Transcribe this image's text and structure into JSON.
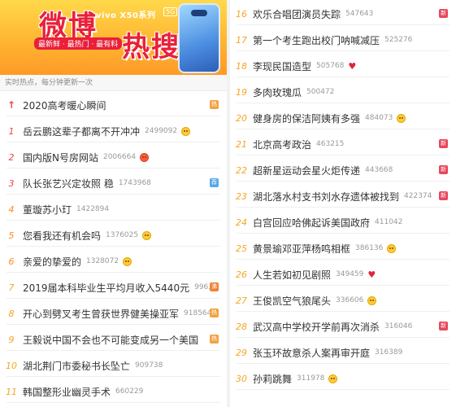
{
  "banner": {
    "title_a": "微博",
    "title_b": "热搜",
    "brand": "vivo X50系列",
    "network": "5G",
    "tagline": "最新鲜 · 最热门 · 最有料"
  },
  "subheader": "实时热点，每分钟更新一次",
  "colors": {
    "accent": "#e8203a",
    "rank_hot": "#f04848",
    "rank_warm": "#ff8a20",
    "rank_norm": "#f6a623"
  },
  "left_items": [
    {
      "rank": "↑",
      "title": "2020高考暖心瞬间",
      "count": "",
      "extra": "",
      "badge": "热"
    },
    {
      "rank": "1",
      "title": "岳云鹏这辈子都离不开冲冲",
      "count": "2499092",
      "extra": "emoji",
      "badge": ""
    },
    {
      "rank": "2",
      "title": "国内版N号房网站",
      "count": "2006664",
      "extra": "emoji-red",
      "badge": ""
    },
    {
      "rank": "3",
      "title": "队长张艺兴定妆照 稳",
      "count": "1743968",
      "extra": "",
      "badge": "荐"
    },
    {
      "rank": "4",
      "title": "董璇苏小玎",
      "count": "1422894",
      "extra": "",
      "badge": ""
    },
    {
      "rank": "5",
      "title": "您看我还有机会吗",
      "count": "1376025",
      "extra": "emoji",
      "badge": ""
    },
    {
      "rank": "6",
      "title": "亲爱的挚爱的",
      "count": "1328072",
      "extra": "emoji",
      "badge": ""
    },
    {
      "rank": "7",
      "title": "2019届本科毕业生平均月收入5440元",
      "count": "996...",
      "extra": "",
      "badge": "沸"
    },
    {
      "rank": "8",
      "title": "开心到劈叉考生曾获世界健美操亚军",
      "count": "918564",
      "extra": "",
      "badge": "热"
    },
    {
      "rank": "9",
      "title": "王毅说中国不会也不可能变成另一个美国",
      "count": "",
      "extra": "",
      "badge": "热"
    },
    {
      "rank": "10",
      "title": "湖北荆门市委秘书长坠亡",
      "count": "909738",
      "extra": "",
      "badge": ""
    },
    {
      "rank": "11",
      "title": "韩国整形业幽灵手术",
      "count": "660229",
      "extra": "",
      "badge": ""
    }
  ],
  "right_items": [
    {
      "rank": "16",
      "title": "欢乐合唱团演员失踪",
      "count": "547643",
      "extra": "",
      "badge": "新"
    },
    {
      "rank": "17",
      "title": "第一个考生跑出校门呐喊减压",
      "count": "525276",
      "extra": "",
      "badge": ""
    },
    {
      "rank": "18",
      "title": "李现民国造型",
      "count": "505768",
      "extra": "heart",
      "badge": ""
    },
    {
      "rank": "19",
      "title": "多肉玫瑰瓜",
      "count": "500472",
      "extra": "",
      "badge": ""
    },
    {
      "rank": "20",
      "title": "健身房的保洁阿姨有多强",
      "count": "484073",
      "extra": "emoji",
      "badge": ""
    },
    {
      "rank": "21",
      "title": "北京高考政治",
      "count": "463215",
      "extra": "",
      "badge": "新"
    },
    {
      "rank": "22",
      "title": "超新星运动会星火炬传递",
      "count": "443668",
      "extra": "",
      "badge": "新"
    },
    {
      "rank": "23",
      "title": "湖北落水村支书刘水存遗体被找到",
      "count": "422374",
      "extra": "",
      "badge": "新"
    },
    {
      "rank": "24",
      "title": "白宫回应哈佛起诉美国政府",
      "count": "411042",
      "extra": "",
      "badge": ""
    },
    {
      "rank": "25",
      "title": "黄景瑜邓亚萍杨鸣相框",
      "count": "386136",
      "extra": "emoji",
      "badge": ""
    },
    {
      "rank": "26",
      "title": "人生若如初见剧照",
      "count": "349459",
      "extra": "heart",
      "badge": ""
    },
    {
      "rank": "27",
      "title": "王俊凯空气狼尾头",
      "count": "336606",
      "extra": "emoji",
      "badge": ""
    },
    {
      "rank": "28",
      "title": "武汉高中学校开学前再次消杀",
      "count": "316046",
      "extra": "",
      "badge": "新"
    },
    {
      "rank": "29",
      "title": "张玉环故意杀人案再审开庭",
      "count": "316389",
      "extra": "",
      "badge": ""
    },
    {
      "rank": "30",
      "title": "孙莉跳舞",
      "count": "311978",
      "extra": "emoji",
      "badge": ""
    }
  ]
}
